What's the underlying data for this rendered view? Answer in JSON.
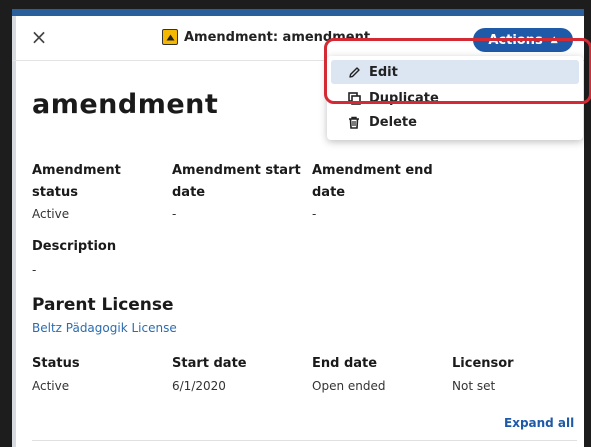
{
  "header": {
    "close_label": "×",
    "title": "Amendment: amendment",
    "actions_label": "Actions",
    "actions_caret": "▲"
  },
  "dropdown": {
    "items": [
      {
        "label": "Edit",
        "icon": "pencil-icon"
      },
      {
        "label": "Duplicate",
        "icon": "duplicate-icon"
      },
      {
        "label": "Delete",
        "icon": "trash-icon"
      }
    ]
  },
  "record": {
    "title": "amendment"
  },
  "fields": {
    "status_label_1": "Amendment",
    "status_label_2": "status",
    "status_value": "Active",
    "start_label_1": "Amendment start",
    "start_label_2": "date",
    "start_value": "-",
    "end_label_1": "Amendment end",
    "end_label_2": "date",
    "end_value": "-",
    "description_label": "Description",
    "description_value": "-"
  },
  "parent_license": {
    "section_title": "Parent License",
    "link": "Beltz Pädagogik License",
    "status_label": "Status",
    "status_value": "Active",
    "start_label": "Start date",
    "start_value": "6/1/2020",
    "end_label": "End date",
    "end_value": "Open ended",
    "licensor_label": "Licensor",
    "licensor_value": "Not set"
  },
  "footer": {
    "expand_all": "Expand all"
  },
  "colors": {
    "accent": "#1e5aa8",
    "highlight": "#d42a33",
    "title_icon": "#f5b800"
  }
}
